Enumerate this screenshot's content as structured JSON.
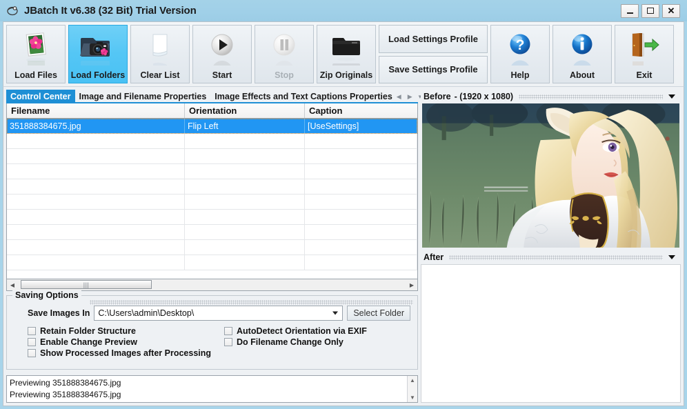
{
  "window": {
    "title": "JBatch It v6.38 (32 Bit) Trial Version",
    "icon": "app-icon",
    "controls": {
      "minimize": "_",
      "maximize": "□",
      "close": "✕"
    },
    "titlebar_color": "#a0d0e8",
    "accent_color": "#1e8fd5"
  },
  "toolbar": {
    "buttons": [
      {
        "label": "Load Files",
        "icon": "photo-icon",
        "state": "normal"
      },
      {
        "label": "Load Folders",
        "icon": "folder-camera-icon",
        "state": "highlighted"
      },
      {
        "label": "Clear List",
        "icon": "blank-page-icon",
        "state": "normal"
      },
      {
        "label": "Start",
        "icon": "play-icon",
        "state": "normal"
      },
      {
        "label": "Stop",
        "icon": "pause-icon",
        "state": "disabled"
      },
      {
        "label": "Zip Originals",
        "icon": "black-folder-icon",
        "state": "normal"
      },
      {
        "label": "Help",
        "icon": "question-sphere-icon",
        "state": "normal"
      },
      {
        "label": "About",
        "icon": "info-sphere-icon",
        "state": "normal"
      },
      {
        "label": "Exit",
        "icon": "door-exit-icon",
        "state": "normal"
      }
    ],
    "load_settings_profile": "Load Settings Profile",
    "save_settings_profile": "Save Settings Profile"
  },
  "tabs": [
    {
      "label": "Control Center",
      "active": true
    },
    {
      "label": "Image and Filename Properties",
      "active": false
    },
    {
      "label": "Image Effects and Text Captions Properties",
      "active": false
    }
  ],
  "tab_nav": {
    "prev": "◀",
    "next": "▶",
    "menu": "▾"
  },
  "file_table": {
    "columns": [
      "Filename",
      "Orientation",
      "Caption"
    ],
    "rows": [
      {
        "filename": "351888384675.jpg",
        "orientation": "Flip Left",
        "caption": "[UseSettings]",
        "selected": true
      }
    ],
    "empty_rows": 9
  },
  "hscroll": {
    "left_arrow": "◀",
    "right_arrow": "▶",
    "grip": "|||"
  },
  "saving_options": {
    "title": "Saving Options",
    "save_images_in_label": "Save Images In",
    "save_path": "C:\\Users\\admin\\Desktop\\",
    "select_folder_button": "Select Folder",
    "checkboxes": [
      {
        "label": "Retain Folder Structure",
        "checked": false
      },
      {
        "label": "AutoDetect Orientation via EXIF",
        "checked": false
      },
      {
        "label": "Enable Change Preview",
        "checked": false
      },
      {
        "label": "Do Filename Change Only",
        "checked": false
      },
      {
        "label": "Show Processed Images after Processing",
        "checked": false
      }
    ]
  },
  "log": {
    "lines": [
      "Previewing 351888384675.jpg",
      "Previewing 351888384675.jpg"
    ],
    "scroll_up": "▲",
    "scroll_down": "▼"
  },
  "preview": {
    "before": {
      "label": "Before",
      "dimensions": "- (1920 x 1080)"
    },
    "after": {
      "label": "After",
      "dimensions": ""
    }
  }
}
